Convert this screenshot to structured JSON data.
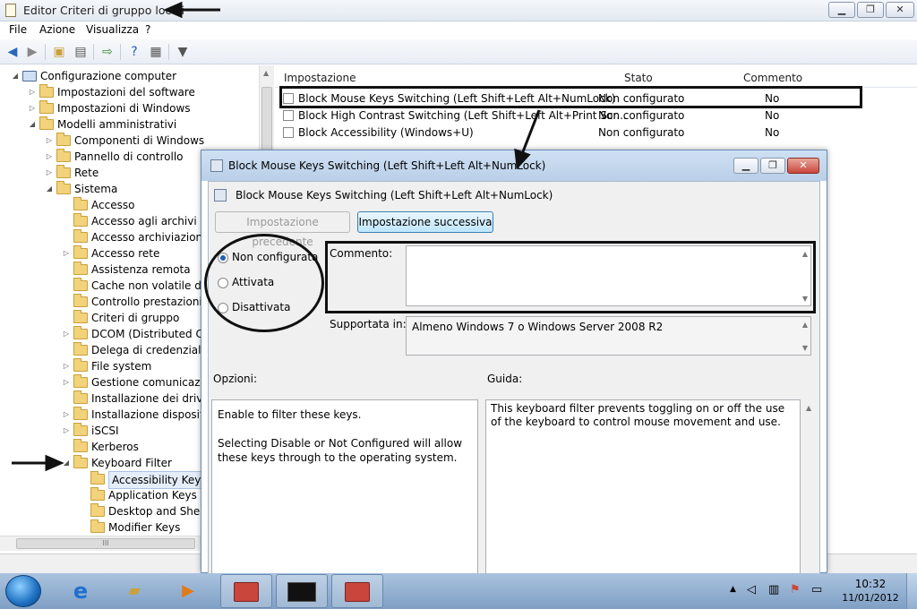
{
  "window": {
    "title": "Editor Criteri di gruppo locali",
    "min": "▁",
    "max": "❐",
    "close": "✕"
  },
  "menu": [
    "File",
    "Azione",
    "Visualizza",
    "?"
  ],
  "tree": [
    {
      "label": "Configurazione computer",
      "level": 0,
      "expander": "◢",
      "kind": "computer"
    },
    {
      "label": "Impostazioni del software",
      "level": 1,
      "expander": "▷",
      "kind": "folder"
    },
    {
      "label": "Impostazioni di Windows",
      "level": 1,
      "expander": "▷",
      "kind": "folder"
    },
    {
      "label": "Modelli amministrativi",
      "level": 1,
      "expander": "◢",
      "kind": "folder"
    },
    {
      "label": "Componenti di Windows",
      "level": 2,
      "expander": "▷",
      "kind": "folder"
    },
    {
      "label": "Pannello di controllo",
      "level": 2,
      "expander": "▷",
      "kind": "folder"
    },
    {
      "label": "Rete",
      "level": 2,
      "expander": "▷",
      "kind": "folder"
    },
    {
      "label": "Sistema",
      "level": 2,
      "expander": "◢",
      "kind": "folder"
    },
    {
      "label": "Accesso",
      "level": 3,
      "expander": "",
      "kind": "folder"
    },
    {
      "label": "Accesso agli archivi rim",
      "level": 3,
      "expander": "",
      "kind": "folder"
    },
    {
      "label": "Accesso archiviazione a",
      "level": 3,
      "expander": "",
      "kind": "folder"
    },
    {
      "label": "Accesso rete",
      "level": 3,
      "expander": "▷",
      "kind": "folder"
    },
    {
      "label": "Assistenza remota",
      "level": 3,
      "expander": "",
      "kind": "folder"
    },
    {
      "label": "Cache non volatile del",
      "level": 3,
      "expander": "",
      "kind": "folder"
    },
    {
      "label": "Controllo prestazioni",
      "level": 3,
      "expander": "",
      "kind": "folder"
    },
    {
      "label": "Criteri di gruppo",
      "level": 3,
      "expander": "",
      "kind": "folder"
    },
    {
      "label": "DCOM (Distributed Com",
      "level": 3,
      "expander": "▷",
      "kind": "folder"
    },
    {
      "label": "Delega di credenziali",
      "level": 3,
      "expander": "",
      "kind": "folder"
    },
    {
      "label": "File system",
      "level": 3,
      "expander": "▷",
      "kind": "folder"
    },
    {
      "label": "Gestione comunicazion",
      "level": 3,
      "expander": "▷",
      "kind": "folder"
    },
    {
      "label": "Installazione dei driver",
      "level": 3,
      "expander": "",
      "kind": "folder"
    },
    {
      "label": "Installazione dispositivi",
      "level": 3,
      "expander": "▷",
      "kind": "folder"
    },
    {
      "label": "iSCSI",
      "level": 3,
      "expander": "▷",
      "kind": "folder"
    },
    {
      "label": "Kerberos",
      "level": 3,
      "expander": "",
      "kind": "folder"
    },
    {
      "label": "Keyboard Filter",
      "level": 3,
      "expander": "◢",
      "kind": "folder"
    },
    {
      "label": "Accessibility Keys",
      "level": 4,
      "expander": "",
      "kind": "folder",
      "selected": true
    },
    {
      "label": "Application Keys",
      "level": 4,
      "expander": "",
      "kind": "folder"
    },
    {
      "label": "Desktop and Shell K",
      "level": 4,
      "expander": "",
      "kind": "folder"
    },
    {
      "label": "Modifier Keys",
      "level": 4,
      "expander": "",
      "kind": "folder"
    }
  ],
  "tree_hscroll_grip": "III",
  "list": {
    "columns": [
      "Impostazione",
      "Stato",
      "Commento"
    ],
    "rows": [
      {
        "name": "Block Mouse Keys Switching (Left Shift+Left Alt+NumLock)",
        "state": "Non configurato",
        "comment": "No"
      },
      {
        "name": "Block High Contrast Switching (Left Shift+Left Alt+Print Scr...",
        "state": "Non configurato",
        "comment": "No"
      },
      {
        "name": "Block Accessibility (Windows+U)",
        "state": "Non configurato",
        "comment": "No"
      }
    ]
  },
  "dialog": {
    "title": "Block Mouse Keys Switching (Left Shift+Left Alt+NumLock)",
    "header": "Block Mouse Keys Switching (Left Shift+Left Alt+NumLock)",
    "prev_btn": "Impostazione precedente",
    "next_btn": "Impostazione successiva",
    "radios": [
      "Non configurata",
      "Attivata",
      "Disattivata"
    ],
    "selected_radio": 0,
    "comment_label": "Commento:",
    "comment_value": "",
    "supported_label": "Supportata in:",
    "supported_value": "Almeno Windows 7 o Windows Server 2008 R2",
    "options_label": "Opzioni:",
    "help_label": "Guida:",
    "options_text_1": "Enable to filter these keys.",
    "options_text_2": "Selecting Disable or Not Configured will allow these keys through to the operating system.",
    "help_text": "This keyboard filter prevents toggling on or off the use of the keyboard to control mouse movement and use.",
    "min": "▁",
    "max": "❐",
    "close": "✕"
  },
  "scroll": {
    "up": "▲",
    "down": "▼"
  },
  "taskbar": {
    "time": "10:32",
    "date": "11/01/2012",
    "tray_up": "▲"
  },
  "colors": {
    "accent": "#1f5fb0",
    "taskbar": "#8fb0d4",
    "close_red": "#c9463d"
  }
}
